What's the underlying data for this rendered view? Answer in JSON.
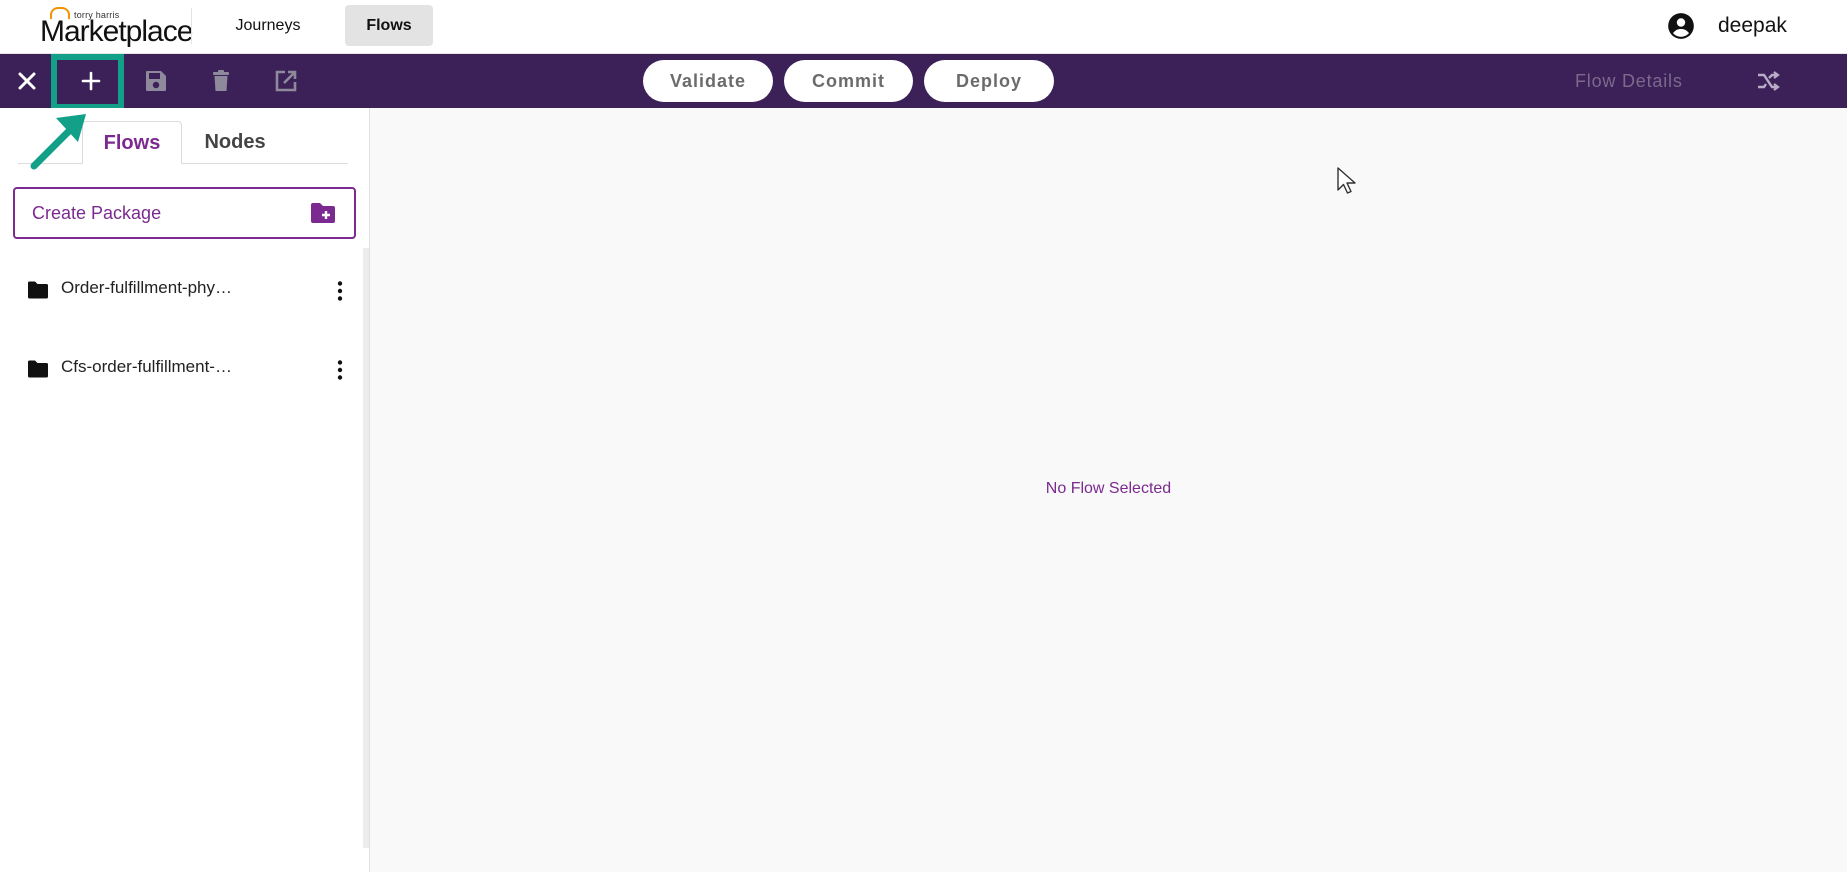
{
  "header": {
    "logo": {
      "small_text": "torry harris",
      "main_text": "Marketplace"
    },
    "nav": [
      {
        "label": "Journeys"
      },
      {
        "label": "Flows"
      }
    ],
    "user": {
      "name": "deepak",
      "icon": "account-circle-icon"
    }
  },
  "toolbar": {
    "icons": [
      "close-icon",
      "plus-icon",
      "save-icon",
      "delete-icon",
      "open-external-icon"
    ],
    "actions": {
      "validate": "Validate",
      "commit": "Commit",
      "deploy": "Deploy"
    },
    "flow_details": "Flow Details",
    "right_icon": "shuffle-icon"
  },
  "sidebar": {
    "tabs": [
      {
        "label": "Flows",
        "active": true
      },
      {
        "label": "Nodes",
        "active": false
      }
    ],
    "create_package": {
      "label": "Create Package",
      "icon": "create-folder-icon"
    },
    "packages": [
      {
        "label": "Order-fulfillment-phy…",
        "icon": "folder-icon"
      },
      {
        "label": "Cfs-order-fulfillment-…",
        "icon": "folder-icon"
      }
    ]
  },
  "canvas": {
    "empty_message": "No Flow Selected"
  },
  "colors": {
    "toolbar_bg": "#3c2058",
    "accent_purple": "#7b2a90",
    "highlight_teal": "#12a088",
    "logo_orange": "#f29100"
  }
}
